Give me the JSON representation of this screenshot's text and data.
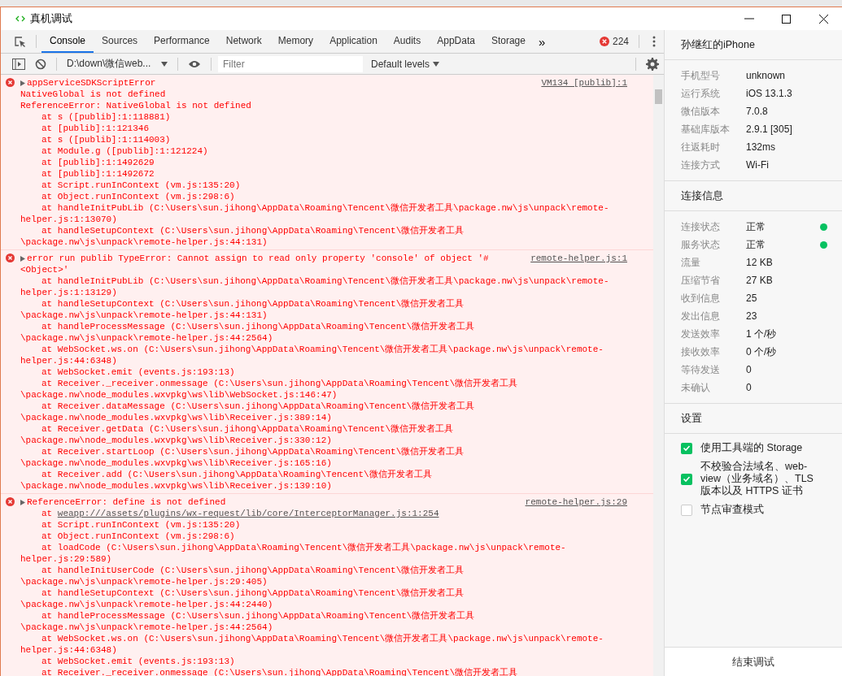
{
  "window": {
    "title": "真机调试"
  },
  "devtools_tabs": [
    {
      "label": "Console",
      "selected": true
    },
    {
      "label": "Sources",
      "selected": false
    },
    {
      "label": "Performance",
      "selected": false
    },
    {
      "label": "Network",
      "selected": false
    },
    {
      "label": "Memory",
      "selected": false
    },
    {
      "label": "Application",
      "selected": false
    },
    {
      "label": "Audits",
      "selected": false
    },
    {
      "label": "AppData",
      "selected": false
    },
    {
      "label": "Storage",
      "selected": false
    }
  ],
  "overflow": "»",
  "error_count": "224",
  "console_toolbar": {
    "context": "D:\\down\\微信web...",
    "filter_placeholder": "Filter",
    "levels": "Default levels"
  },
  "messages": [
    {
      "source": "VM134 [publib]:1",
      "lines": [
        {
          "kind": "head",
          "text": "appServiceSDKScriptError"
        },
        {
          "kind": "text",
          "text": "NativeGlobal is not defined"
        },
        {
          "kind": "text",
          "text": "ReferenceError: NativeGlobal is not defined"
        },
        {
          "kind": "frame",
          "text": "at s ([publib]:1:118881)"
        },
        {
          "kind": "frame",
          "text": "at [publib]:1:121346"
        },
        {
          "kind": "frame",
          "text": "at s ([publib]:1:114003)"
        },
        {
          "kind": "frame",
          "text": "at Module.g ([publib]:1:121224)"
        },
        {
          "kind": "frame",
          "text": "at [publib]:1:1492629"
        },
        {
          "kind": "frame",
          "text": "at [publib]:1:1492672"
        },
        {
          "kind": "frame",
          "text": "at Script.runInContext (vm.js:135:20)"
        },
        {
          "kind": "frame",
          "text": "at Object.runInContext (vm.js:298:6)"
        },
        {
          "kind": "frame",
          "text": "at handleInitPubLib (C:\\Users\\sun.jihong\\AppData\\Roaming\\Tencent\\微信开发者工具\\package.nw\\js\\unpack\\remote-"
        },
        {
          "kind": "text",
          "text": "helper.js:1:13070)"
        },
        {
          "kind": "frame",
          "text": "at handleSetupContext (C:\\Users\\sun.jihong\\AppData\\Roaming\\Tencent\\微信开发者工具"
        },
        {
          "kind": "text",
          "text": "\\package.nw\\js\\unpack\\remote-helper.js:44:131)"
        }
      ]
    },
    {
      "source": "remote-helper.js:1",
      "lines": [
        {
          "kind": "head",
          "text": "error run publib TypeError: Cannot assign to read only property 'console' of object '#"
        },
        {
          "kind": "text",
          "text": "<Object>'"
        },
        {
          "kind": "frame",
          "text": "at handleInitPubLib (C:\\Users\\sun.jihong\\AppData\\Roaming\\Tencent\\微信开发者工具\\package.nw\\js\\unpack\\remote-"
        },
        {
          "kind": "text",
          "text": "helper.js:1:13129)"
        },
        {
          "kind": "frame",
          "text": "at handleSetupContext (C:\\Users\\sun.jihong\\AppData\\Roaming\\Tencent\\微信开发者工具"
        },
        {
          "kind": "text",
          "text": "\\package.nw\\js\\unpack\\remote-helper.js:44:131)"
        },
        {
          "kind": "frame",
          "text": "at handleProcessMessage (C:\\Users\\sun.jihong\\AppData\\Roaming\\Tencent\\微信开发者工具"
        },
        {
          "kind": "text",
          "text": "\\package.nw\\js\\unpack\\remote-helper.js:44:2564)"
        },
        {
          "kind": "frame",
          "text": "at WebSocket.ws.on (C:\\Users\\sun.jihong\\AppData\\Roaming\\Tencent\\微信开发者工具\\package.nw\\js\\unpack\\remote-"
        },
        {
          "kind": "text",
          "text": "helper.js:44:6348)"
        },
        {
          "kind": "frame",
          "text": "at WebSocket.emit (events.js:193:13)"
        },
        {
          "kind": "frame",
          "text": "at Receiver._receiver.onmessage (C:\\Users\\sun.jihong\\AppData\\Roaming\\Tencent\\微信开发者工具"
        },
        {
          "kind": "text",
          "text": "\\package.nw\\node_modules.wxvpkg\\ws\\lib\\WebSocket.js:146:47)"
        },
        {
          "kind": "frame",
          "text": "at Receiver.dataMessage (C:\\Users\\sun.jihong\\AppData\\Roaming\\Tencent\\微信开发者工具"
        },
        {
          "kind": "text",
          "text": "\\package.nw\\node_modules.wxvpkg\\ws\\lib\\Receiver.js:389:14)"
        },
        {
          "kind": "frame",
          "text": "at Receiver.getData (C:\\Users\\sun.jihong\\AppData\\Roaming\\Tencent\\微信开发者工具"
        },
        {
          "kind": "text",
          "text": "\\package.nw\\node_modules.wxvpkg\\ws\\lib\\Receiver.js:330:12)"
        },
        {
          "kind": "frame",
          "text": "at Receiver.startLoop (C:\\Users\\sun.jihong\\AppData\\Roaming\\Tencent\\微信开发者工具"
        },
        {
          "kind": "text",
          "text": "\\package.nw\\node_modules.wxvpkg\\ws\\lib\\Receiver.js:165:16)"
        },
        {
          "kind": "frame",
          "text": "at Receiver.add (C:\\Users\\sun.jihong\\AppData\\Roaming\\Tencent\\微信开发者工具"
        },
        {
          "kind": "text",
          "text": "\\package.nw\\node_modules.wxvpkg\\ws\\lib\\Receiver.js:139:10)"
        }
      ]
    },
    {
      "source": "remote-helper.js:29",
      "lines": [
        {
          "kind": "head",
          "text": "ReferenceError: define is not defined"
        },
        {
          "kind": "frame",
          "text": "at ",
          "link": "weapp:///assets/plugins/wx-request/lib/core/InterceptorManager.js:1:254"
        },
        {
          "kind": "frame",
          "text": "at Script.runInContext (vm.js:135:20)"
        },
        {
          "kind": "frame",
          "text": "at Object.runInContext (vm.js:298:6)"
        },
        {
          "kind": "frame",
          "text": "at loadCode (C:\\Users\\sun.jihong\\AppData\\Roaming\\Tencent\\微信开发者工具\\package.nw\\js\\unpack\\remote-"
        },
        {
          "kind": "text",
          "text": "helper.js:29:589)"
        },
        {
          "kind": "frame",
          "text": "at handleInitUserCode (C:\\Users\\sun.jihong\\AppData\\Roaming\\Tencent\\微信开发者工具"
        },
        {
          "kind": "text",
          "text": "\\package.nw\\js\\unpack\\remote-helper.js:29:405)"
        },
        {
          "kind": "frame",
          "text": "at handleSetupContext (C:\\Users\\sun.jihong\\AppData\\Roaming\\Tencent\\微信开发者工具"
        },
        {
          "kind": "text",
          "text": "\\package.nw\\js\\unpack\\remote-helper.js:44:2440)"
        },
        {
          "kind": "frame",
          "text": "at handleProcessMessage (C:\\Users\\sun.jihong\\AppData\\Roaming\\Tencent\\微信开发者工具"
        },
        {
          "kind": "text",
          "text": "\\package.nw\\js\\unpack\\remote-helper.js:44:2564)"
        },
        {
          "kind": "frame",
          "text": "at WebSocket.ws.on (C:\\Users\\sun.jihong\\AppData\\Roaming\\Tencent\\微信开发者工具\\package.nw\\js\\unpack\\remote-"
        },
        {
          "kind": "text",
          "text": "helper.js:44:6348)"
        },
        {
          "kind": "frame",
          "text": "at WebSocket.emit (events.js:193:13)"
        },
        {
          "kind": "frame",
          "text": "at Receiver._receiver.onmessage (C:\\Users\\sun.jihong\\AppData\\Roaming\\Tencent\\微信开发者工具"
        }
      ]
    }
  ],
  "device_panel": {
    "device_name": "孙继红的iPhone",
    "info": [
      {
        "label": "手机型号",
        "value": "unknown"
      },
      {
        "label": "运行系统",
        "value": "iOS 13.1.3"
      },
      {
        "label": "微信版本",
        "value": "7.0.8"
      },
      {
        "label": "基础库版本",
        "value": "2.9.1 [305]"
      },
      {
        "label": "往返耗时",
        "value": "132ms"
      },
      {
        "label": "连接方式",
        "value": "Wi-Fi"
      }
    ],
    "connection_title": "连接信息",
    "connection": [
      {
        "label": "连接状态",
        "value": "正常",
        "color": "#07c160"
      },
      {
        "label": "服务状态",
        "value": "正常",
        "color": "#07c160"
      },
      {
        "label": "流量",
        "value": "12 KB"
      },
      {
        "label": "压缩节省",
        "value": "27 KB"
      },
      {
        "label": "收到信息",
        "value": "25"
      },
      {
        "label": "发出信息",
        "value": "23"
      },
      {
        "label": "发送效率",
        "value": "1 个/秒"
      },
      {
        "label": "接收效率",
        "value": "0 个/秒"
      },
      {
        "label": "等待发送",
        "value": "0"
      },
      {
        "label": "未确认",
        "value": "0"
      }
    ],
    "settings_title": "设置",
    "settings": [
      {
        "label": "使用工具端的 Storage",
        "checked": true
      },
      {
        "label": "不校验合法域名、web-view（业务域名）、TLS 版本以及 HTTPS 证书",
        "checked": true
      },
      {
        "label": "节点审查模式",
        "checked": false
      }
    ],
    "end_button": "结束调试"
  }
}
